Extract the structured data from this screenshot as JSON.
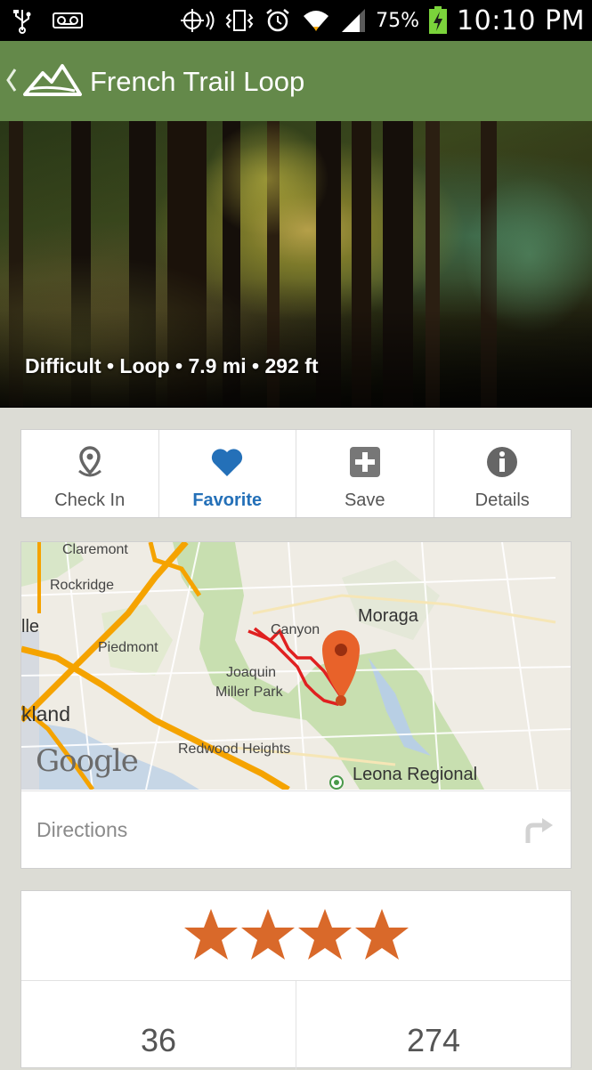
{
  "status_bar": {
    "battery_percent": "75%",
    "time": "10:10 PM",
    "icons": [
      "usb-icon",
      "voicemail-icon",
      "gps-icon",
      "vibrate-icon",
      "alarm-icon",
      "wifi-icon",
      "signal-icon",
      "battery-charging-icon"
    ]
  },
  "action_bar": {
    "title": "French Trail Loop",
    "background_color": "#64894a"
  },
  "hero": {
    "caption": "Difficult • Loop • 7.9 mi • 292 ft"
  },
  "actions": [
    {
      "label": "Check In",
      "icon": "location-pin-icon",
      "active": false
    },
    {
      "label": "Favorite",
      "icon": "heart-icon",
      "active": true
    },
    {
      "label": "Save",
      "icon": "plus-square-icon",
      "active": false
    },
    {
      "label": "Details",
      "icon": "info-icon",
      "active": false
    }
  ],
  "map": {
    "places": {
      "claremont": "Claremont",
      "rockridge": "Rockridge",
      "piedmont": "Piedmont",
      "moraga": "Moraga",
      "canyon": "Canyon",
      "joaquin": "Joaquin",
      "miller_park": "Miller Park",
      "oakland_fragment": "kland",
      "berkeley_fragment": "lle",
      "redwood_heights": "Redwood Heights",
      "leona_regional": "Leona Regional"
    },
    "attribution": "Google"
  },
  "directions": {
    "label": "Directions"
  },
  "rating": {
    "stars": 4
  },
  "stats": [
    "36",
    "274"
  ],
  "colors": {
    "accent_active": "#2470b8",
    "star": "#d9692a",
    "trail": "#e02020",
    "map_pin": "#e8622a"
  }
}
